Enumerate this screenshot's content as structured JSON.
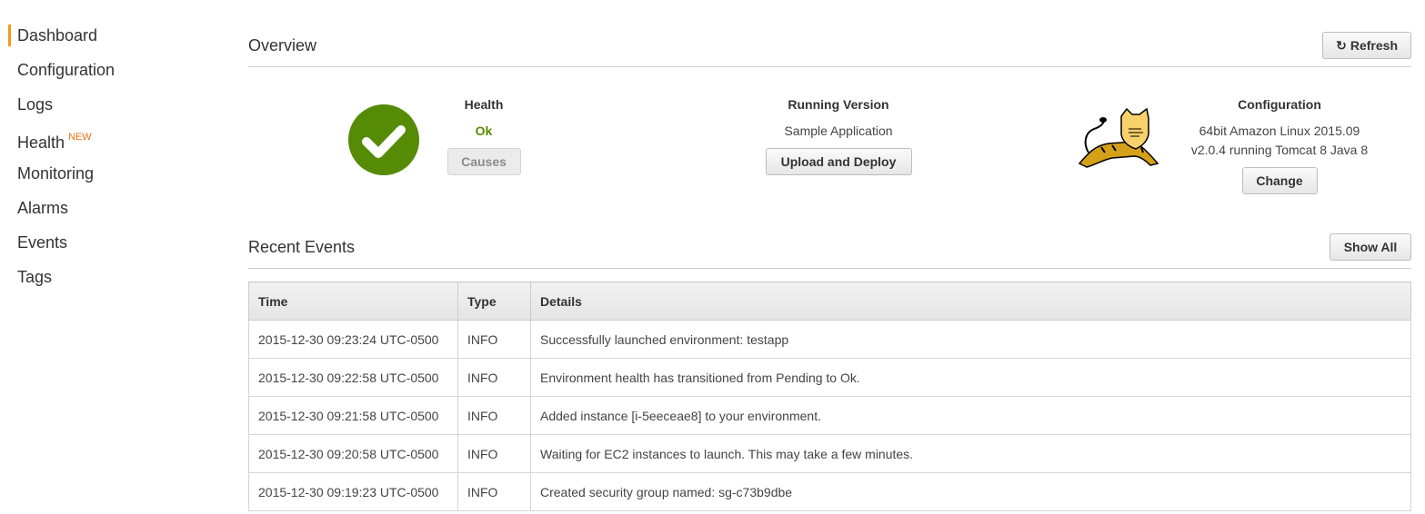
{
  "sidebar": {
    "items": [
      {
        "label": "Dashboard",
        "active": true
      },
      {
        "label": "Configuration"
      },
      {
        "label": "Logs"
      },
      {
        "label": "Health",
        "badge": "NEW"
      },
      {
        "label": "Monitoring"
      },
      {
        "label": "Alarms"
      },
      {
        "label": "Events"
      },
      {
        "label": "Tags"
      }
    ],
    "accent_color": "#f7981d"
  },
  "overview": {
    "title": "Overview",
    "refresh_label": "Refresh",
    "refresh_icon": "refresh-icon",
    "health": {
      "label": "Health",
      "status": "Ok",
      "status_color": "#5a8a00",
      "icon": "check-circle-icon",
      "causes_label": "Causes"
    },
    "running_version": {
      "label": "Running Version",
      "value": "Sample Application",
      "upload_label": "Upload and Deploy"
    },
    "configuration": {
      "label": "Configuration",
      "line1": "64bit Amazon Linux 2015.09",
      "line2": "v2.0.4 running Tomcat 8 Java 8",
      "change_label": "Change",
      "icon": "tomcat-logo-icon"
    }
  },
  "events": {
    "title": "Recent Events",
    "show_all_label": "Show All",
    "columns": [
      "Time",
      "Type",
      "Details"
    ],
    "rows": [
      {
        "time": "2015-12-30 09:23:24 UTC-0500",
        "type": "INFO",
        "details": "Successfully launched environment: testapp"
      },
      {
        "time": "2015-12-30 09:22:58 UTC-0500",
        "type": "INFO",
        "details": "Environment health has transitioned from Pending to Ok."
      },
      {
        "time": "2015-12-30 09:21:58 UTC-0500",
        "type": "INFO",
        "details": "Added instance [i-5eeceae8] to your environment."
      },
      {
        "time": "2015-12-30 09:20:58 UTC-0500",
        "type": "INFO",
        "details": "Waiting for EC2 instances to launch. This may take a few minutes."
      },
      {
        "time": "2015-12-30 09:19:23 UTC-0500",
        "type": "INFO",
        "details": "Created security group named: sg-c73b9dbe"
      }
    ]
  }
}
